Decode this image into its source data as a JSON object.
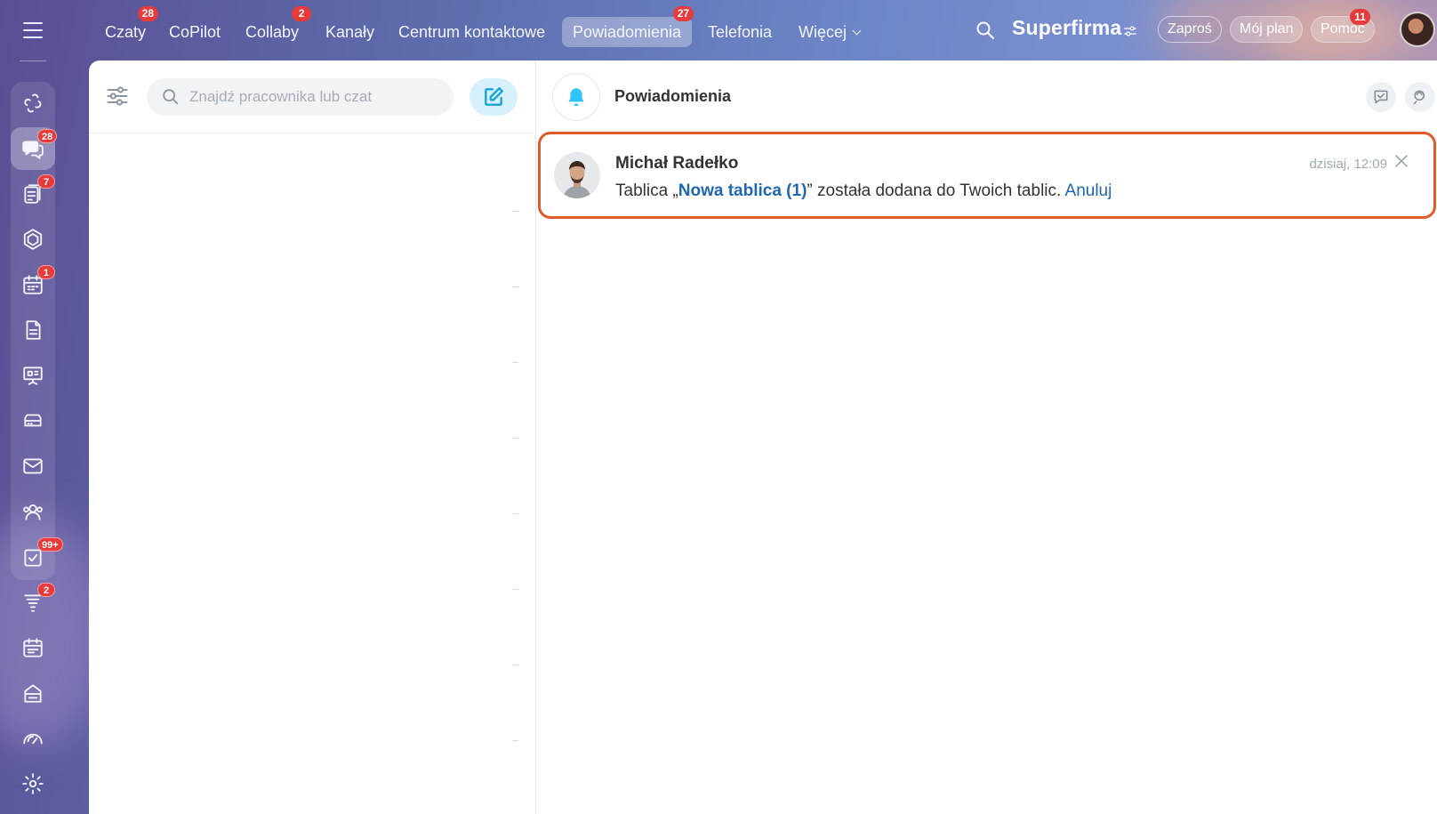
{
  "topnav": {
    "tabs": [
      {
        "label": "Czaty",
        "badge": "28"
      },
      {
        "label": "CoPilot",
        "badge": ""
      },
      {
        "label": "Collaby",
        "badge": "2"
      },
      {
        "label": "Kanały",
        "badge": ""
      },
      {
        "label": "Centrum kontaktowe",
        "badge": ""
      },
      {
        "label": "Powiadomienia",
        "badge": "27"
      },
      {
        "label": "Telefonia",
        "badge": ""
      },
      {
        "label": "Więcej",
        "badge": ""
      }
    ],
    "active_tab": "Powiadomienia",
    "brand": "Superfirma",
    "invite": "Zaproś",
    "plan": "Mój plan",
    "help": "Pomoc",
    "help_badge": "11"
  },
  "sidebar": {
    "items": [
      {
        "icon": "copilot-icon",
        "badge": ""
      },
      {
        "icon": "chat-bubbles-icon",
        "badge": "28",
        "active": true
      },
      {
        "icon": "feed-icon",
        "badge": "7"
      },
      {
        "icon": "hexagon-icon",
        "badge": ""
      },
      {
        "icon": "calendar-icon",
        "badge": "1"
      },
      {
        "icon": "document-icon",
        "badge": ""
      },
      {
        "icon": "presentation-icon",
        "badge": ""
      },
      {
        "icon": "drive-icon",
        "badge": ""
      },
      {
        "icon": "mail-icon",
        "badge": ""
      },
      {
        "icon": "users-icon",
        "badge": ""
      },
      {
        "icon": "tasks-icon",
        "badge": "99+"
      },
      {
        "icon": "funnel-icon",
        "badge": "2"
      },
      {
        "icon": "schedule-icon",
        "badge": ""
      },
      {
        "icon": "store-icon",
        "badge": ""
      },
      {
        "icon": "speedometer-icon",
        "badge": ""
      },
      {
        "icon": "gear-icon",
        "badge": ""
      }
    ]
  },
  "left_pane": {
    "search_placeholder": "Znajdź pracownika lub czat"
  },
  "right_pane": {
    "title": "Powiadomienia",
    "notification": {
      "author": "Michał Radełko",
      "time": "dzisiaj, 12:09",
      "text_before": "Tablica „",
      "board_link": "Nowa tablica (1)",
      "text_after": "” została dodana do Twoich tablic. ",
      "cancel_link": "Anuluj"
    }
  },
  "colors": {
    "accent": "#2fc6f6",
    "link": "#2067b0",
    "badge": "#e73a3a",
    "highlight_border": "#e05a2b"
  }
}
